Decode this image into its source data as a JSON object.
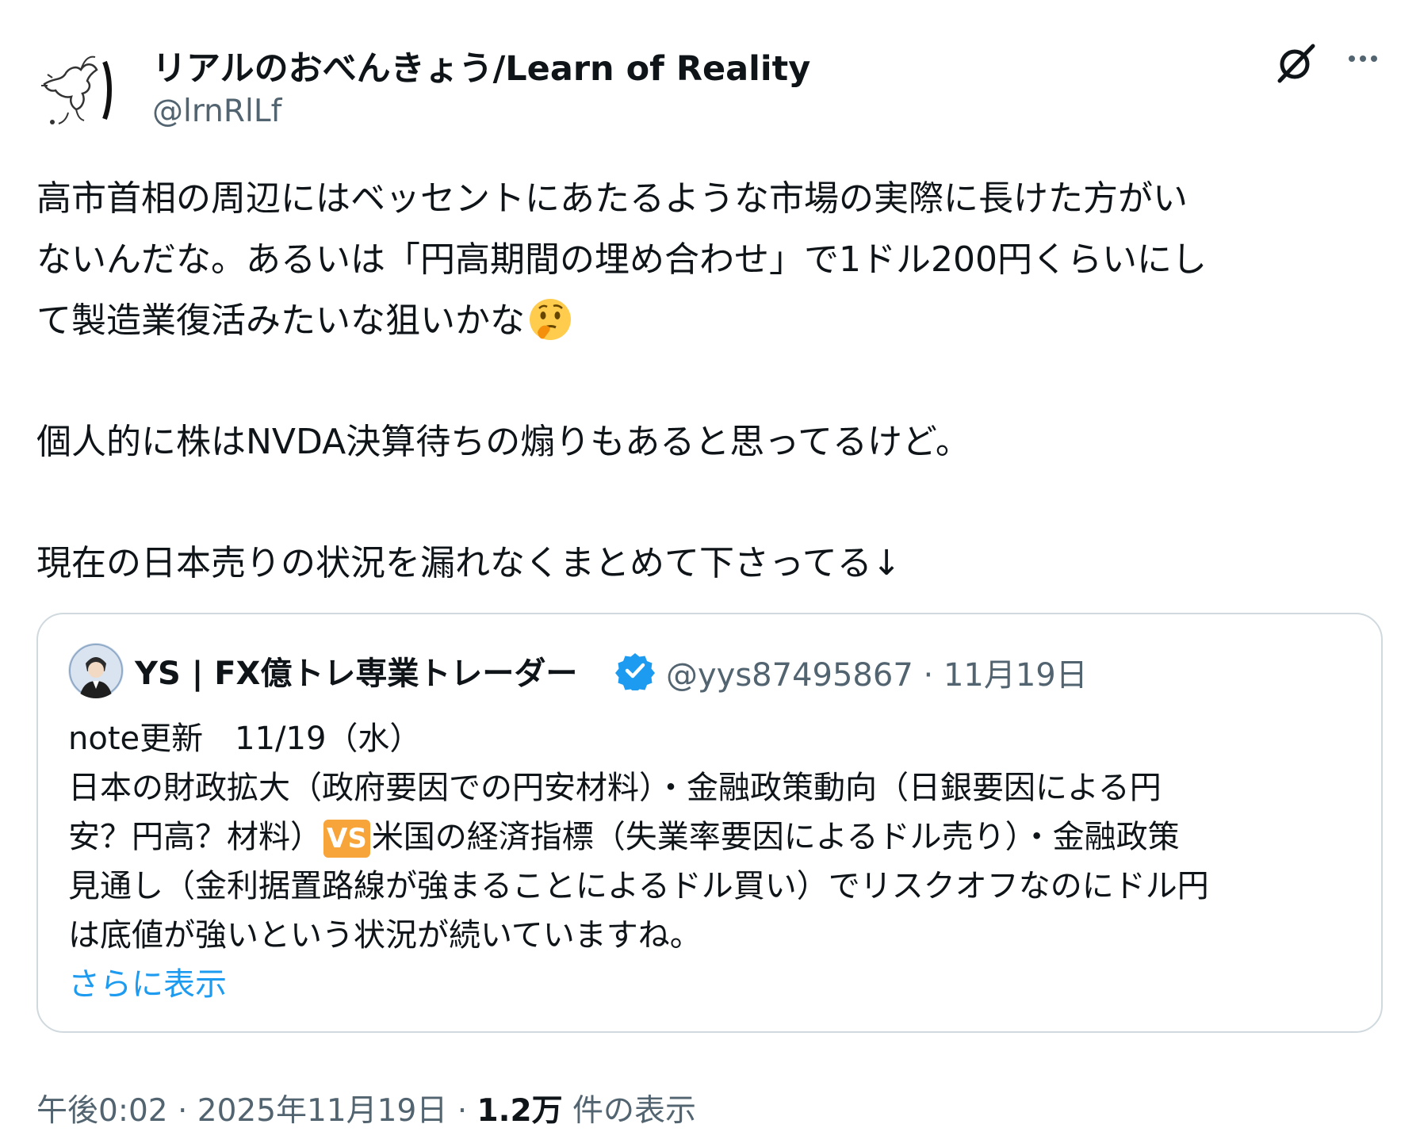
{
  "author": {
    "display_name": "リアルのおべんきょう/Learn of Reality",
    "handle": "@lrnRlLf",
    "avatar_icon": "bird-sketch-avatar"
  },
  "actions": {
    "grok_icon": "grok-icon",
    "more_icon": "more-icon",
    "more_label": "···"
  },
  "tweet": {
    "line1": "高市首相の周辺にはベッセントにあたるような市場の実際に長けた方がい",
    "line2": "ないんだな。あるいは「円高期間の埋め合わせ」で1ドル200円くらいにし",
    "line3": "て製造業復活みたいな狙いかな",
    "line3_emoji": "thinking-face-emoji",
    "para2": "個人的に株はNVDA決算待ちの煽りもあると思ってるけど。",
    "para3": "現在の日本売りの状況を漏れなくまとめて下さってる↓"
  },
  "quote": {
    "display_name": "YS | FX億トレ専業トレーダー",
    "verified_icon": "verified-badge-icon",
    "handle": "@yys87495867",
    "separator": "·",
    "date": "11月19日",
    "line1": "note更新　11/19（水）",
    "line2": "日本の財政拡大（政府要因での円安材料）・金融政策動向（日銀要因による円",
    "line3a": "安？円高？材料）",
    "vs_label": "VS",
    "line3b": "米国の経済指標（失業率要因によるドル売り）・金融政策",
    "line4": "見通し（金利据置路線が強まることによるドル買い）でリスクオフなのにドル円",
    "line5": "は底値が強いという状況が続いていますね。",
    "show_more": "さらに表示"
  },
  "footer": {
    "time": "午後0:02",
    "sep1": " · ",
    "date": "2025年11月19日",
    "sep2": " · ",
    "views_count": "1.2万",
    "views_label": " 件の表示"
  },
  "colors": {
    "text": "#0f1419",
    "secondary": "#536471",
    "link": "#1d9bf0",
    "border": "#cfd9de",
    "vs_bg": "#f7a43a"
  }
}
